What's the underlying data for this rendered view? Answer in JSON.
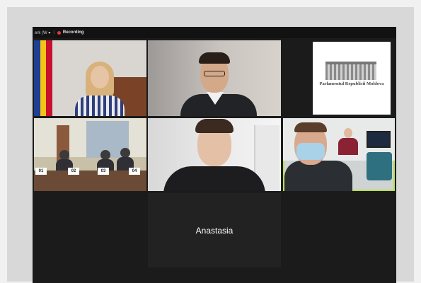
{
  "meeting": {
    "view_label": "erk (W ▾",
    "recording_label": "Recording"
  },
  "tiles": {
    "top_right_logo_text": "Parlamentul Republicii Moldova",
    "room_nameplates": [
      "01",
      "02",
      "03",
      "04"
    ],
    "name_only_participant": "Anastasia"
  },
  "colors": {
    "active_speaker_border": "#b9e04a",
    "recording_dot": "#e53935",
    "flag_blue": "#1f3f93",
    "flag_yellow": "#f2c318",
    "flag_red": "#c8102e"
  }
}
